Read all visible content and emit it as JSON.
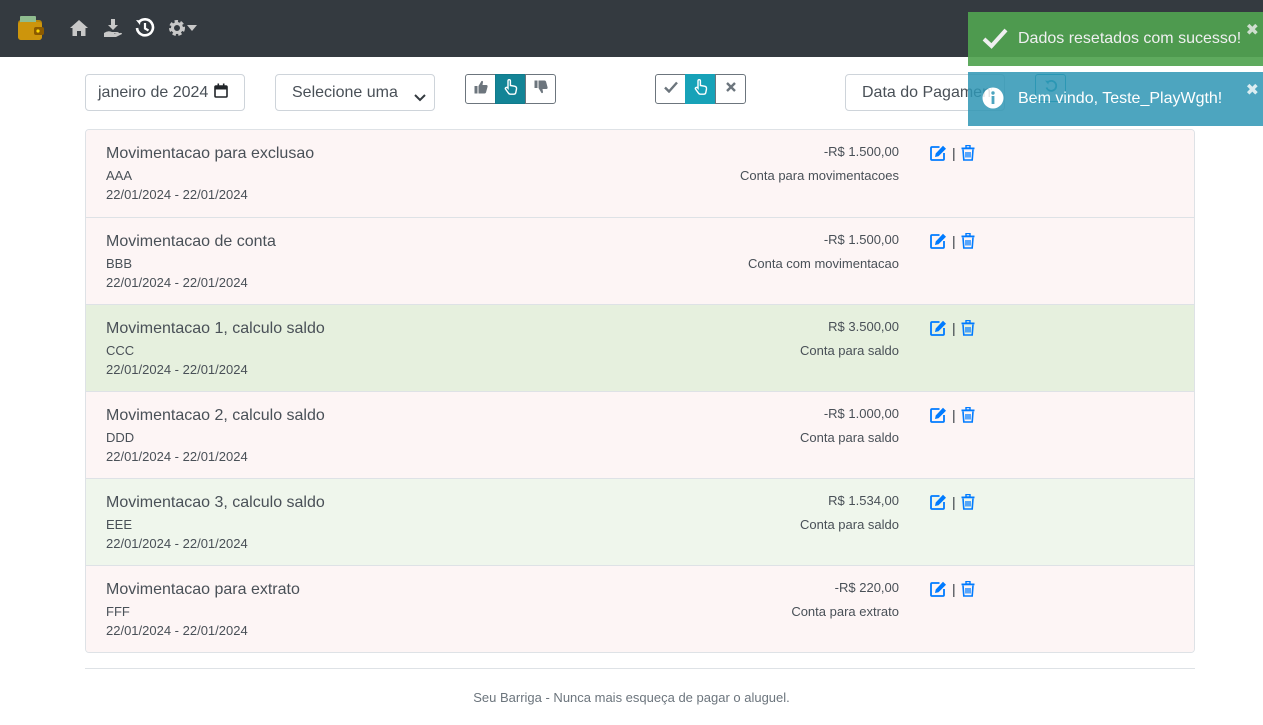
{
  "navbar": {
    "icons": [
      "wallet-icon",
      "home-icon",
      "hand-holding-money-icon",
      "history-icon",
      "gear-icon",
      "caret-down-icon"
    ]
  },
  "filters": {
    "month": "janeiro de 2024",
    "conta_placeholder": "Selecione uma conta",
    "date_type": "Data do Pagamento"
  },
  "movimentacoes": [
    {
      "title": "Movimentacao para exclusao",
      "desc": "AAA",
      "dates": "22/01/2024 - 22/01/2024",
      "value": "-R$ 1.500,00",
      "conta": "Conta para movimentacoes",
      "tipo": "despesa"
    },
    {
      "title": "Movimentacao de conta",
      "desc": "BBB",
      "dates": "22/01/2024 - 22/01/2024",
      "value": "-R$ 1.500,00",
      "conta": "Conta com movimentacao",
      "tipo": "despesa"
    },
    {
      "title": "Movimentacao 1, calculo saldo",
      "desc": "CCC",
      "dates": "22/01/2024 - 22/01/2024",
      "value": "R$ 3.500,00",
      "conta": "Conta para saldo",
      "tipo": "receita"
    },
    {
      "title": "Movimentacao 2, calculo saldo",
      "desc": "DDD",
      "dates": "22/01/2024 - 22/01/2024",
      "value": "-R$ 1.000,00",
      "conta": "Conta para saldo",
      "tipo": "despesa"
    },
    {
      "title": "Movimentacao 3, calculo saldo",
      "desc": "EEE",
      "dates": "22/01/2024 - 22/01/2024",
      "value": "R$ 1.534,00",
      "conta": "Conta para saldo",
      "tipo": "receita"
    },
    {
      "title": "Movimentacao para extrato",
      "desc": "FFF",
      "dates": "22/01/2024 - 22/01/2024",
      "value": "-R$ 220,00",
      "conta": "Conta para extrato",
      "tipo": "despesa"
    }
  ],
  "actions": {
    "separator": "|"
  },
  "footer": {
    "text": "Seu Barriga - Nunca mais esqueça de pagar o aluguel."
  },
  "toasts": [
    {
      "type": "success",
      "message": "Dados resetados com sucesso!",
      "close": "✖"
    },
    {
      "type": "info",
      "message": "Bem vindo, Teste_PlayWgth!",
      "close": "✖"
    }
  ],
  "colors": {
    "navbar": "#343a40",
    "accent": "#17a2b8",
    "link": "#007bff",
    "success": "#51a351",
    "info": "#2f96b4"
  }
}
